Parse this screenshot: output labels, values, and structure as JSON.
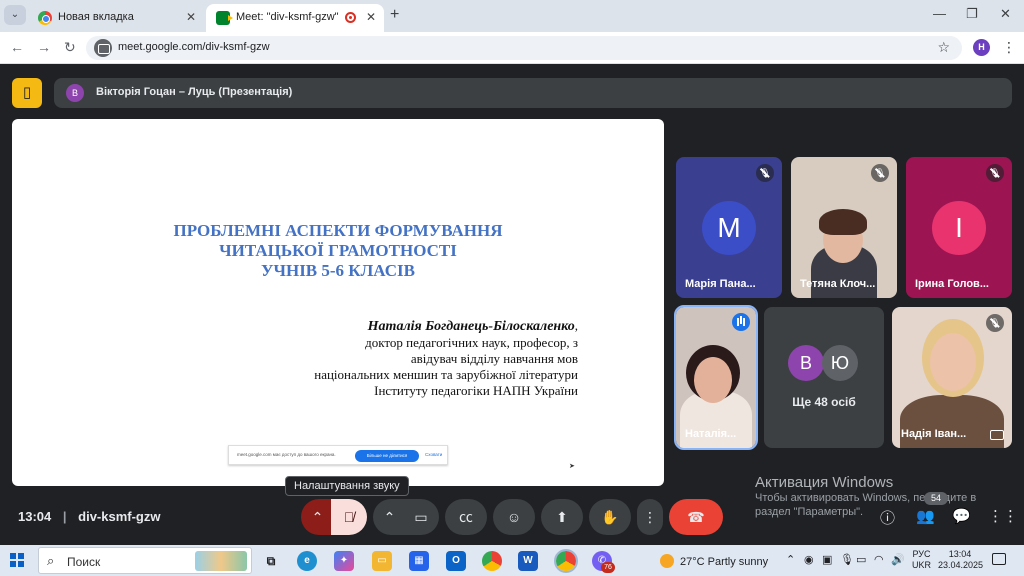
{
  "browser": {
    "tabs": [
      {
        "title": "Новая вкладка",
        "active": false
      },
      {
        "title": "Meet: \"div-ksmf-gzw\"",
        "active": true
      }
    ],
    "url": "meet.google.com/div-ksmf-gzw",
    "profile_initial": "H"
  },
  "meet": {
    "presenter": {
      "initial": "В",
      "label": "Вікторія Гоцан – Луць (Презентація)"
    },
    "slide": {
      "title_lines": [
        "ПРОБЛЕМНІ АСПЕКТИ ФОРМУВАННЯ",
        "ЧИТАЦЬКОЇ ГРАМОТНОСТІ",
        "УЧНІВ 5-6 КЛАСІВ"
      ],
      "author_name": "Наталія Богданець-Білоскаленко",
      "author_lines": [
        "доктор педагогічних наук, професор, з",
        "авідувач відділу навчання мов",
        "національних меншин та зарубіжної літератури",
        "Інституту педагогіки НАПН України"
      ],
      "share_bar": {
        "message": "meet.google.com має доступ до вашого екрана.",
        "stop_label": "Більше не ділитися",
        "hide_label": "Сховати"
      }
    },
    "participants": [
      {
        "initial": "М",
        "name": "Марія Пана...",
        "color": "#3c4dc8",
        "muted": true
      },
      {
        "initial": "",
        "name": "Тетяна Клоч...",
        "color": "#c9b8a8",
        "muted": true
      },
      {
        "initial": "І",
        "name": "Ірина Голов...",
        "color": "#c2185b",
        "muted": true
      },
      {
        "initial": "",
        "name": "Наталія...",
        "color": "#d8c0b0",
        "muted": false
      },
      {
        "initial": "",
        "name": "Надія Іван...",
        "color": "#e8d8cc",
        "muted": true
      }
    ],
    "others": {
      "initials": [
        "В",
        "Ю"
      ],
      "label": "Ще 48 осіб"
    },
    "tooltip": "Налаштування звуку",
    "clock": "13:04",
    "meeting_code": "div-ksmf-gzw",
    "people_count": "54"
  },
  "windows_activation": {
    "title": "Активация Windows",
    "line1": "Чтобы активировать Windows, перейдите в",
    "line2": "раздел \"Параметры\"."
  },
  "taskbar": {
    "search_placeholder": "Поиск",
    "weather": "27°C  Partly sunny",
    "viber_badge": "76",
    "language": [
      "РУС",
      "UKR"
    ],
    "time": "13:04",
    "date": "23.04.2025"
  }
}
